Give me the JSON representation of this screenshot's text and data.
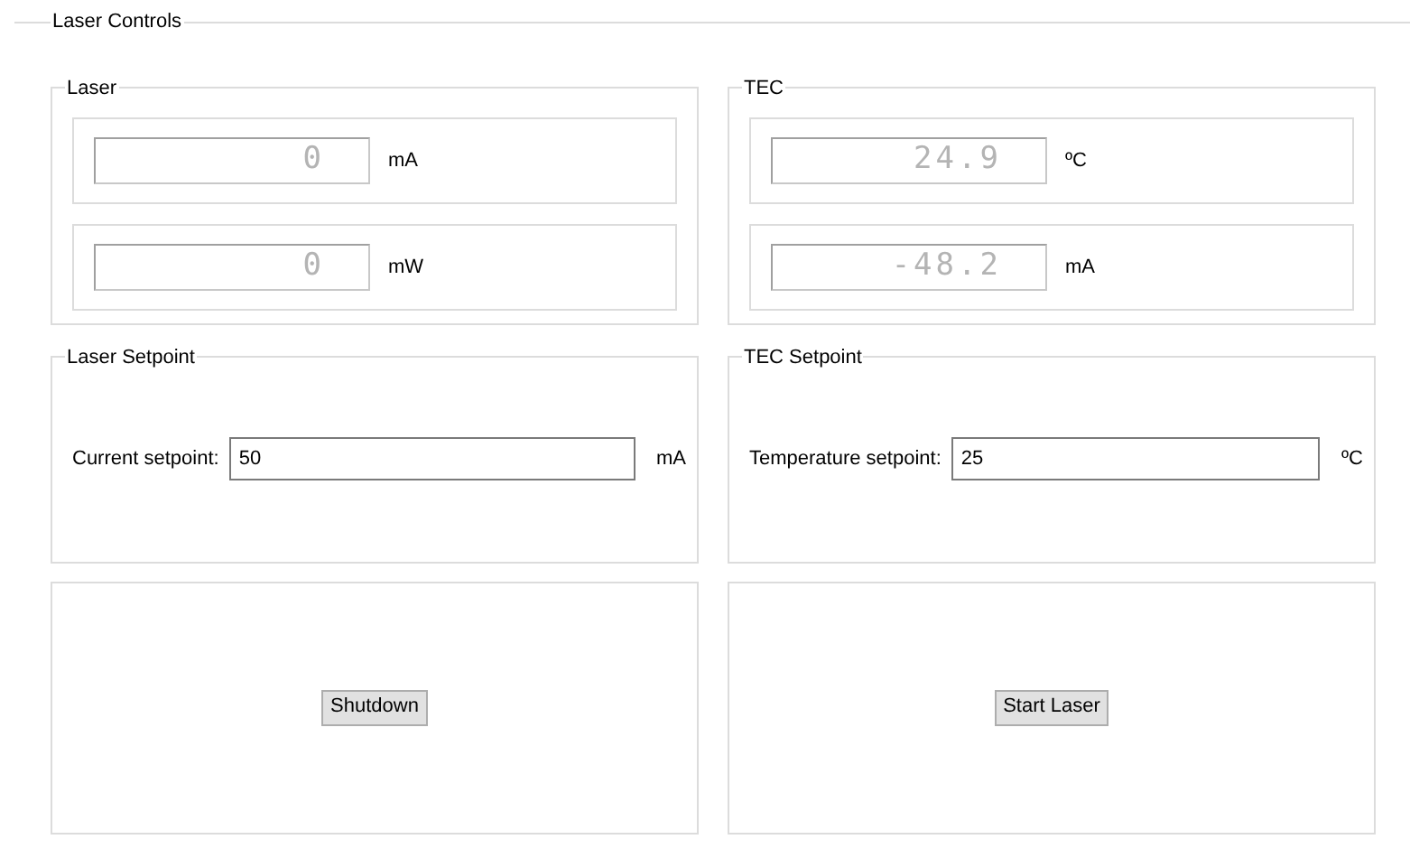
{
  "group": {
    "title": "Laser Controls"
  },
  "panels": [
    {
      "title": "Laser",
      "readouts": [
        {
          "value": "0",
          "unit": "mA"
        },
        {
          "value": "0",
          "unit": "mW"
        }
      ]
    },
    {
      "title": "TEC",
      "readouts": [
        {
          "value": "24.9",
          "unit": "ºC"
        },
        {
          "value": "-48.2",
          "unit": "mA"
        }
      ]
    }
  ],
  "setpoints": [
    {
      "title": "Laser Setpoint",
      "label": "Current setpoint:",
      "value": "50",
      "unit": "mA"
    },
    {
      "title": "TEC Setpoint",
      "label": "Temperature setpoint:",
      "value": "25",
      "unit": "ºC"
    }
  ],
  "buttons": [
    {
      "label": "Shutdown"
    },
    {
      "label": "Start Laser"
    }
  ]
}
